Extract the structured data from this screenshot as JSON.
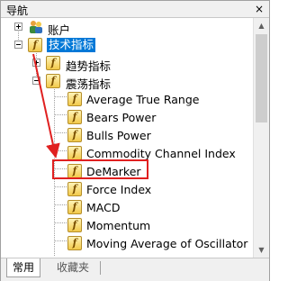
{
  "window": {
    "title": "导航",
    "close_label": "×"
  },
  "tree": {
    "accounts_label": "账户",
    "tech_indicators_label": "技术指标",
    "trend_label": "趋势指标",
    "oscillators_label": "震荡指标",
    "oscillator_items": [
      "Average True Range",
      "Bears Power",
      "Bulls Power",
      "Commodity Channel Index",
      "DeMarker",
      "Force Index",
      "MACD",
      "Momentum",
      "Moving Average of Oscillator"
    ],
    "highlighted_item": "DeMarker"
  },
  "tabs": {
    "common": "常用",
    "favorites": "收藏夹"
  },
  "colors": {
    "selection": "#0078d7",
    "highlight_box": "#e02020",
    "arrow": "#e02020"
  },
  "icons": {
    "indicator": "f-function-icon",
    "accounts": "accounts-people-icon"
  }
}
